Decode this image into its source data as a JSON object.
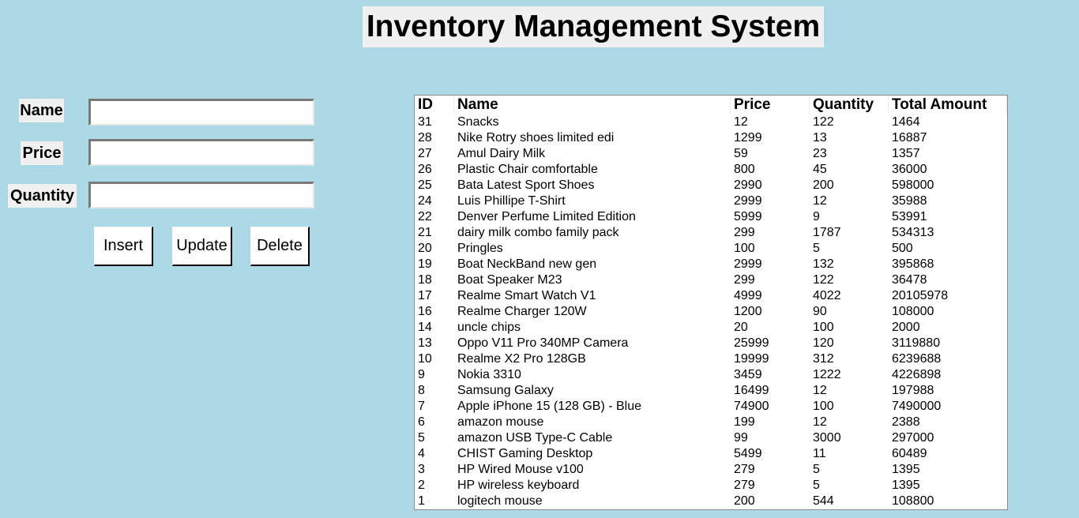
{
  "title": "Inventory Management System",
  "form": {
    "name_label": "Name",
    "price_label": "Price",
    "quantity_label": "Quantity",
    "name_value": "",
    "price_value": "",
    "quantity_value": "",
    "insert_label": "Insert",
    "update_label": "Update",
    "delete_label": "Delete"
  },
  "table": {
    "headers": [
      "ID",
      "Name",
      "Price",
      "Quantity",
      "Total Amount"
    ],
    "rows": [
      [
        "31",
        "Snacks",
        "12",
        "122",
        "1464"
      ],
      [
        "28",
        "Nike Rotry shoes limited edi",
        "1299",
        "13",
        "16887"
      ],
      [
        "27",
        "Amul Dairy Milk",
        "59",
        "23",
        "1357"
      ],
      [
        "26",
        "Plastic Chair comfortable",
        "800",
        "45",
        "36000"
      ],
      [
        "25",
        "Bata Latest Sport Shoes",
        "2990",
        "200",
        "598000"
      ],
      [
        "24",
        "Luis Phillipe T-Shirt",
        "2999",
        "12",
        "35988"
      ],
      [
        "22",
        "Denver Perfume Limited Edition",
        "5999",
        "9",
        "53991"
      ],
      [
        "21",
        "dairy milk combo family pack",
        "299",
        "1787",
        "534313"
      ],
      [
        "20",
        "Pringles",
        "100",
        "5",
        "500"
      ],
      [
        "19",
        "Boat NeckBand new gen",
        "2999",
        "132",
        "395868"
      ],
      [
        "18",
        "Boat Speaker M23",
        "299",
        "122",
        "36478"
      ],
      [
        "17",
        "Realme Smart Watch V1",
        "4999",
        "4022",
        "20105978"
      ],
      [
        "16",
        "Realme Charger 120W",
        "1200",
        "90",
        "108000"
      ],
      [
        "14",
        "uncle chips",
        "20",
        "100",
        "2000"
      ],
      [
        "13",
        "Oppo V11 Pro 340MP Camera",
        "25999",
        "120",
        "3119880"
      ],
      [
        "10",
        "Realme X2 Pro 128GB",
        "19999",
        "312",
        "6239688"
      ],
      [
        "9",
        "Nokia 3310",
        "3459",
        "1222",
        "4226898"
      ],
      [
        "8",
        "Samsung Galaxy",
        "16499",
        "12",
        "197988"
      ],
      [
        "7",
        "Apple iPhone 15 (128 GB) - Blue",
        "74900",
        "100",
        "7490000"
      ],
      [
        "6",
        "amazon mouse",
        "199",
        "12",
        "2388"
      ],
      [
        "5",
        "amazon USB Type-C Cable",
        "99",
        "3000",
        "297000"
      ],
      [
        "4",
        "CHIST Gaming Desktop",
        "5499",
        "11",
        "60489"
      ],
      [
        "3",
        "HP Wired Mouse v100",
        "279",
        "5",
        "1395"
      ],
      [
        "2",
        "HP wireless keyboard",
        "279",
        "5",
        "1395"
      ],
      [
        "1",
        "logitech mouse",
        "200",
        "544",
        "108800"
      ]
    ]
  }
}
